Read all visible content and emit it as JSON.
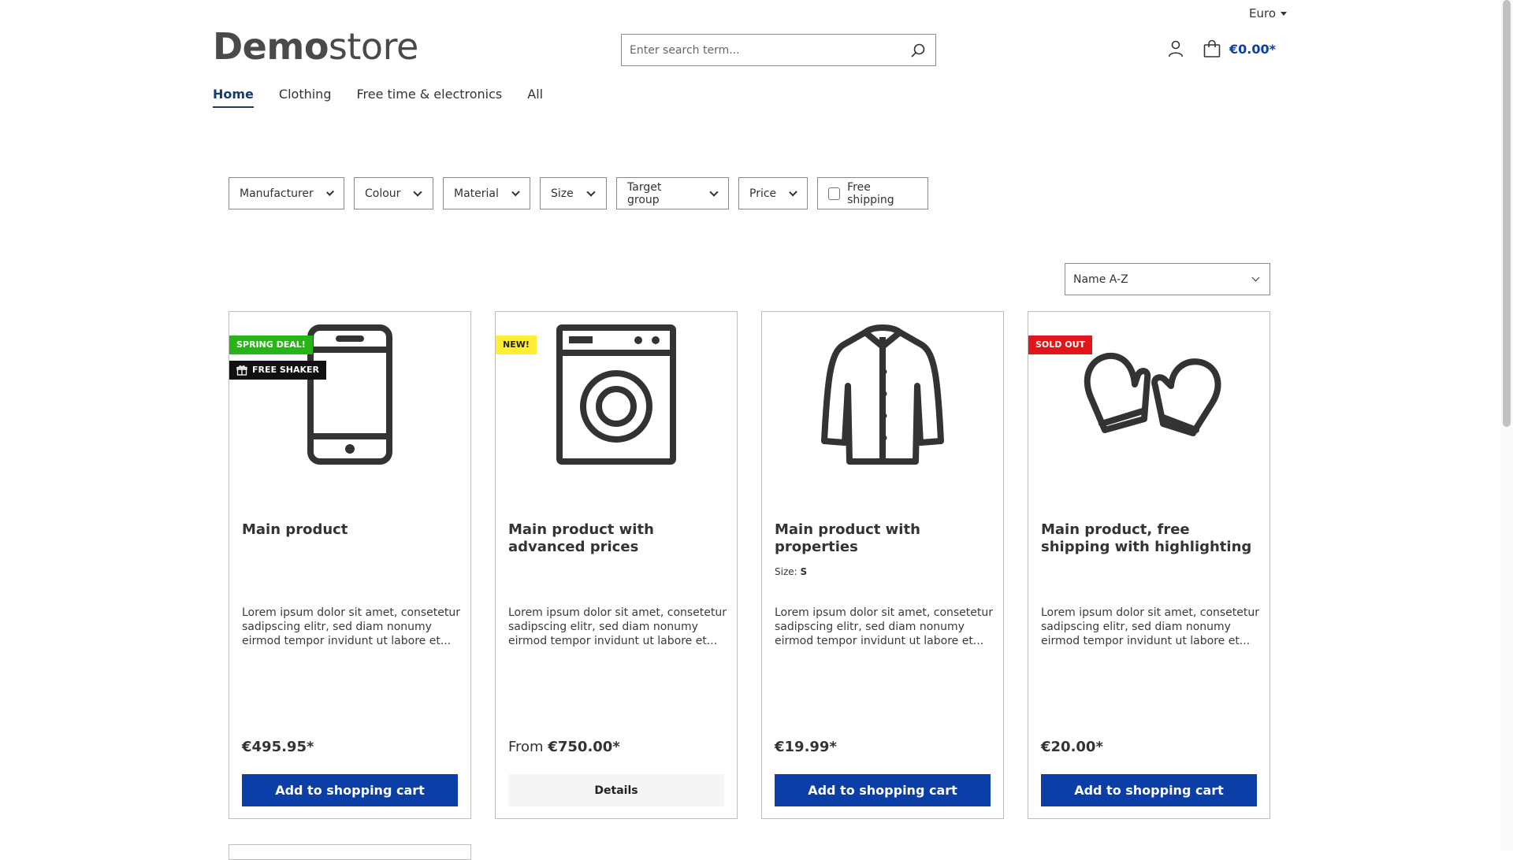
{
  "currency": {
    "label": "Euro"
  },
  "logo": {
    "bold": "Demo",
    "light": "store"
  },
  "search": {
    "placeholder": "Enter search term..."
  },
  "cart": {
    "total": "€0.00*"
  },
  "nav": [
    {
      "label": "Home",
      "active": true
    },
    {
      "label": "Clothing"
    },
    {
      "label": "Free time & electronics"
    },
    {
      "label": "All"
    }
  ],
  "filters": {
    "manufacturer": "Manufacturer",
    "colour": "Colour",
    "material": "Material",
    "size": "Size",
    "target_group": "Target group",
    "price": "Price",
    "free_shipping": "Free shipping"
  },
  "sort": {
    "selected": "Name A-Z"
  },
  "products": [
    {
      "name": "Main product",
      "badges": [
        "SPRING DEAL!",
        "FREE SHAKER"
      ],
      "description": "Lorem ipsum dolor sit amet, consetetur sadipscing elitr, sed diam nonumy eirmod tempor invidunt ut labore et...",
      "price": "€495.95*",
      "button": "Add to shopping cart",
      "icon": "smartphone-icon"
    },
    {
      "name": "Main product with advanced prices",
      "badges": [
        "NEW!"
      ],
      "description": "Lorem ipsum dolor sit amet, consetetur sadipscing elitr, sed diam nonumy eirmod tempor invidunt ut labore et...",
      "price_prefix": "From",
      "price": "€750.00*",
      "button": "Details",
      "icon": "washing-machine-icon"
    },
    {
      "name": "Main product with properties",
      "property_label": "Size:",
      "property_value": "S",
      "description": "Lorem ipsum dolor sit amet, consetetur sadipscing elitr, sed diam nonumy eirmod tempor invidunt ut labore et...",
      "price": "€19.99*",
      "button": "Add to shopping cart",
      "icon": "jacket-icon"
    },
    {
      "name": "Main product, free shipping with highlighting",
      "badges": [
        "SOLD OUT"
      ],
      "description": "Lorem ipsum dolor sit amet, consetetur sadipscing elitr, sed diam nonumy eirmod tempor invidunt ut labore et...",
      "price": "€20.00*",
      "button": "Add to shopping cart",
      "icon": "mittens-icon"
    }
  ],
  "colors": {
    "primary": "#0b3ea6",
    "badge_green": "#26b416",
    "badge_yellow": "#ffee32",
    "badge_red": "#e3151a"
  }
}
